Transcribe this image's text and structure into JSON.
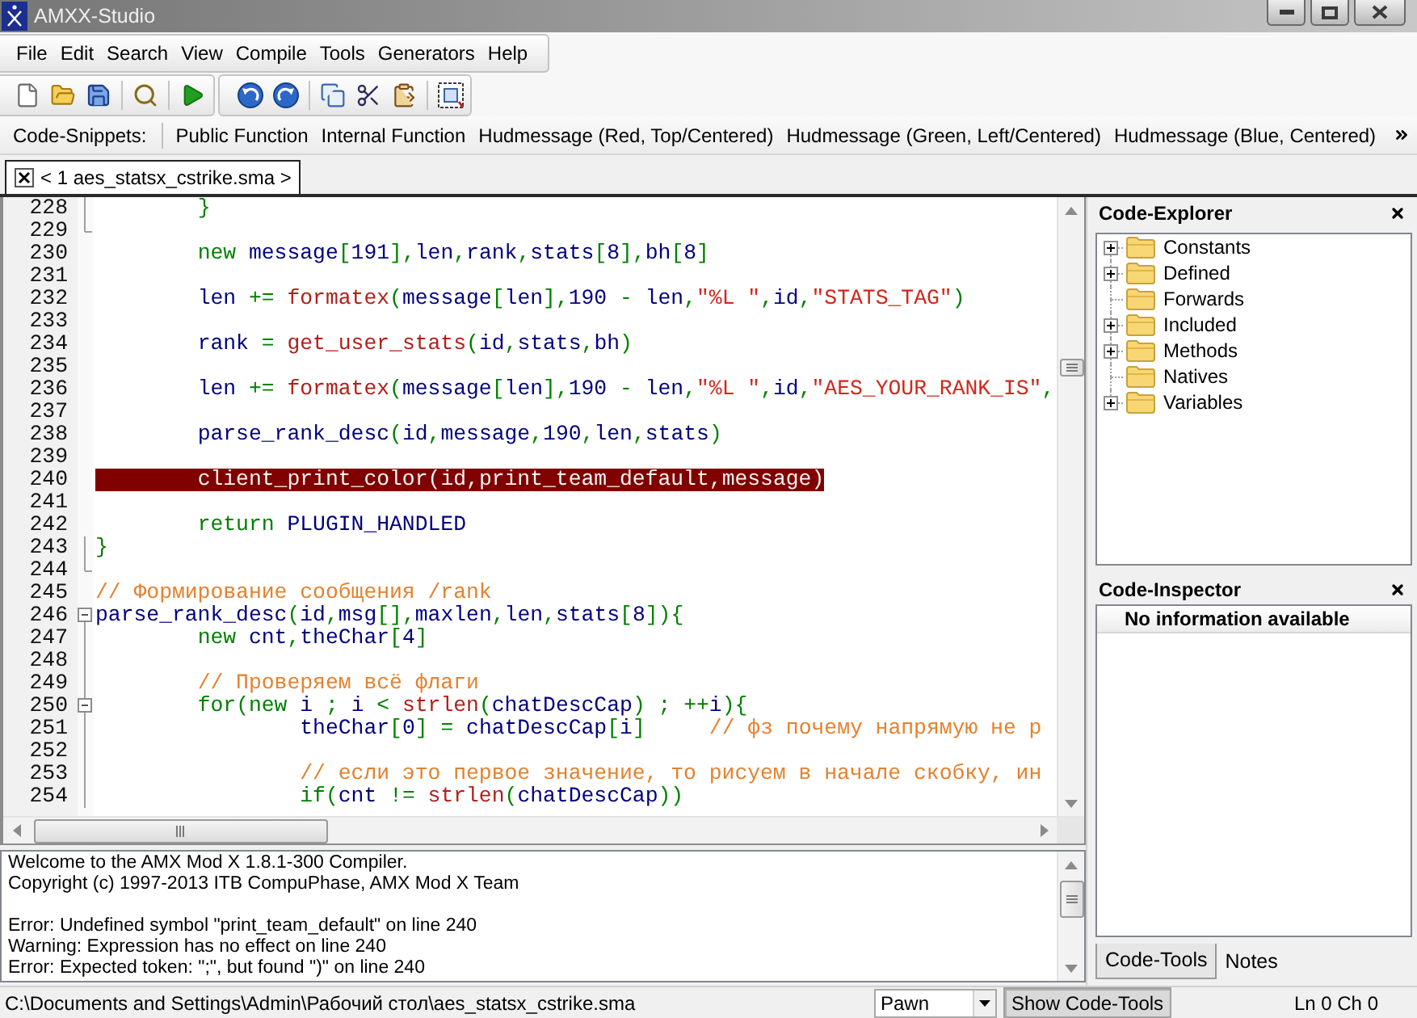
{
  "window": {
    "title": "AMXX-Studio"
  },
  "menu": [
    "File",
    "Edit",
    "Search",
    "View",
    "Compile",
    "Tools",
    "Generators",
    "Help"
  ],
  "snippets": {
    "label": "Code-Snippets:",
    "items": [
      "Public Function",
      "Internal Function",
      "Hudmessage (Red, Top/Centered)",
      "Hudmessage (Green, Left/Centered)",
      "Hudmessage (Blue, Centered)"
    ]
  },
  "tabs": [
    {
      "label": "< 1 aes_statsx_cstrike.sma >",
      "selected": true
    }
  ],
  "editor": {
    "lines": [
      {
        "number": "228",
        "kind": "fold_line",
        "highlighted": false,
        "tokens": [
          {
            "kind": "op",
            "text": "        }"
          }
        ]
      },
      {
        "number": "229",
        "kind": "fold_end",
        "highlighted": false
      },
      {
        "number": "230",
        "kind": "plain",
        "highlighted": false,
        "tokens": [
          {
            "kind": "kw",
            "text": "        new"
          },
          {
            "kind": "id",
            "text": " message"
          },
          {
            "kind": "op",
            "text": "["
          },
          {
            "kind": "id",
            "text": "191"
          },
          {
            "kind": "op",
            "text": "],"
          },
          {
            "kind": "id",
            "text": "len"
          },
          {
            "kind": "op",
            "text": ","
          },
          {
            "kind": "id",
            "text": "rank"
          },
          {
            "kind": "op",
            "text": ","
          },
          {
            "kind": "id",
            "text": "stats"
          },
          {
            "kind": "op",
            "text": "["
          },
          {
            "kind": "id",
            "text": "8"
          },
          {
            "kind": "op",
            "text": "],"
          },
          {
            "kind": "id",
            "text": "bh"
          },
          {
            "kind": "op",
            "text": "["
          },
          {
            "kind": "id",
            "text": "8"
          },
          {
            "kind": "op",
            "text": "]"
          }
        ]
      },
      {
        "number": "231",
        "kind": "plain",
        "highlighted": false
      },
      {
        "number": "232",
        "kind": "plain",
        "highlighted": false,
        "tokens": [
          {
            "kind": "id",
            "text": "        len "
          },
          {
            "kind": "op",
            "text": "+= "
          },
          {
            "kind": "fn",
            "text": "formatex"
          },
          {
            "kind": "op",
            "text": "("
          },
          {
            "kind": "id",
            "text": "message"
          },
          {
            "kind": "op",
            "text": "["
          },
          {
            "kind": "id",
            "text": "len"
          },
          {
            "kind": "op",
            "text": "],"
          },
          {
            "kind": "id",
            "text": "190 "
          },
          {
            "kind": "op",
            "text": "- "
          },
          {
            "kind": "id",
            "text": "len"
          },
          {
            "kind": "op",
            "text": ","
          },
          {
            "kind": "str",
            "text": "\"%L \""
          },
          {
            "kind": "op",
            "text": ","
          },
          {
            "kind": "id",
            "text": "id"
          },
          {
            "kind": "op",
            "text": ","
          },
          {
            "kind": "str",
            "text": "\"STATS_TAG\""
          },
          {
            "kind": "op",
            "text": ")"
          }
        ]
      },
      {
        "number": "233",
        "kind": "plain",
        "highlighted": false
      },
      {
        "number": "234",
        "kind": "plain",
        "highlighted": false,
        "tokens": [
          {
            "kind": "id",
            "text": "        rank "
          },
          {
            "kind": "op",
            "text": "= "
          },
          {
            "kind": "fn",
            "text": "get_user_stats"
          },
          {
            "kind": "op",
            "text": "("
          },
          {
            "kind": "id",
            "text": "id"
          },
          {
            "kind": "op",
            "text": ","
          },
          {
            "kind": "id",
            "text": "stats"
          },
          {
            "kind": "op",
            "text": ","
          },
          {
            "kind": "id",
            "text": "bh"
          },
          {
            "kind": "op",
            "text": ")"
          }
        ]
      },
      {
        "number": "235",
        "kind": "plain",
        "highlighted": false
      },
      {
        "number": "236",
        "kind": "plain",
        "highlighted": false,
        "tokens": [
          {
            "kind": "id",
            "text": "        len "
          },
          {
            "kind": "op",
            "text": "+= "
          },
          {
            "kind": "fn",
            "text": "formatex"
          },
          {
            "kind": "op",
            "text": "("
          },
          {
            "kind": "id",
            "text": "message"
          },
          {
            "kind": "op",
            "text": "["
          },
          {
            "kind": "id",
            "text": "len"
          },
          {
            "kind": "op",
            "text": "],"
          },
          {
            "kind": "id",
            "text": "190 "
          },
          {
            "kind": "op",
            "text": "- "
          },
          {
            "kind": "id",
            "text": "len"
          },
          {
            "kind": "op",
            "text": ","
          },
          {
            "kind": "str",
            "text": "\"%L \""
          },
          {
            "kind": "op",
            "text": ","
          },
          {
            "kind": "id",
            "text": "id"
          },
          {
            "kind": "op",
            "text": ","
          },
          {
            "kind": "str",
            "text": "\"AES_YOUR_RANK_IS\""
          },
          {
            "kind": "op",
            "text": ","
          }
        ]
      },
      {
        "number": "237",
        "kind": "plain",
        "highlighted": false
      },
      {
        "number": "238",
        "kind": "plain",
        "highlighted": false,
        "tokens": [
          {
            "kind": "id",
            "text": "        parse_rank_desc"
          },
          {
            "kind": "op",
            "text": "("
          },
          {
            "kind": "id",
            "text": "id"
          },
          {
            "kind": "op",
            "text": ","
          },
          {
            "kind": "id",
            "text": "message"
          },
          {
            "kind": "op",
            "text": ","
          },
          {
            "kind": "id",
            "text": "190"
          },
          {
            "kind": "op",
            "text": ","
          },
          {
            "kind": "id",
            "text": "len"
          },
          {
            "kind": "op",
            "text": ","
          },
          {
            "kind": "id",
            "text": "stats"
          },
          {
            "kind": "op",
            "text": ")"
          }
        ]
      },
      {
        "number": "239",
        "kind": "plain",
        "highlighted": false
      },
      {
        "number": "240",
        "kind": "plain",
        "highlighted": true,
        "tokens": [
          {
            "kind": "id",
            "text": "        client_print_color"
          },
          {
            "kind": "op",
            "text": "("
          },
          {
            "kind": "id",
            "text": "id"
          },
          {
            "kind": "op",
            "text": ","
          },
          {
            "kind": "id",
            "text": "print_team_default"
          },
          {
            "kind": "op",
            "text": ","
          },
          {
            "kind": "id",
            "text": "message"
          },
          {
            "kind": "op",
            "text": ")"
          }
        ]
      },
      {
        "number": "241",
        "kind": "plain",
        "highlighted": false
      },
      {
        "number": "242",
        "kind": "plain",
        "highlighted": false,
        "tokens": [
          {
            "kind": "kw",
            "text": "        return"
          },
          {
            "kind": "id",
            "text": " PLUGIN_HANDLED"
          }
        ]
      },
      {
        "number": "243",
        "kind": "fold_line",
        "highlighted": false,
        "tokens": [
          {
            "kind": "op",
            "text": "}"
          }
        ]
      },
      {
        "number": "244",
        "kind": "fold_end",
        "highlighted": false
      },
      {
        "number": "245",
        "kind": "plain",
        "highlighted": false,
        "tokens": [
          {
            "kind": "comment",
            "text": "// Формирование сообщения /rank"
          }
        ]
      },
      {
        "number": "246",
        "kind": "fold_start",
        "highlighted": false,
        "tokens": [
          {
            "kind": "id",
            "text": "parse_rank_desc"
          },
          {
            "kind": "op",
            "text": "("
          },
          {
            "kind": "id",
            "text": "id"
          },
          {
            "kind": "op",
            "text": ","
          },
          {
            "kind": "id",
            "text": "msg"
          },
          {
            "kind": "op",
            "text": "[],"
          },
          {
            "kind": "id",
            "text": "maxlen"
          },
          {
            "kind": "op",
            "text": ","
          },
          {
            "kind": "id",
            "text": "len"
          },
          {
            "kind": "op",
            "text": ","
          },
          {
            "kind": "id",
            "text": "stats"
          },
          {
            "kind": "op",
            "text": "["
          },
          {
            "kind": "id",
            "text": "8"
          },
          {
            "kind": "op",
            "text": "]){"
          }
        ]
      },
      {
        "number": "247",
        "kind": "fold_line",
        "highlighted": false,
        "tokens": [
          {
            "kind": "kw",
            "text": "        new"
          },
          {
            "kind": "id",
            "text": " cnt"
          },
          {
            "kind": "op",
            "text": ","
          },
          {
            "kind": "id",
            "text": "theChar"
          },
          {
            "kind": "op",
            "text": "["
          },
          {
            "kind": "id",
            "text": "4"
          },
          {
            "kind": "op",
            "text": "]"
          }
        ]
      },
      {
        "number": "248",
        "kind": "fold_line",
        "highlighted": false
      },
      {
        "number": "249",
        "kind": "fold_line",
        "highlighted": false,
        "tokens": [
          {
            "kind": "comment",
            "text": "        // Проверяем всё флаги"
          }
        ]
      },
      {
        "number": "250",
        "kind": "fold_inner_start",
        "highlighted": false,
        "tokens": [
          {
            "kind": "kw",
            "text": "        for"
          },
          {
            "kind": "op",
            "text": "("
          },
          {
            "kind": "kw",
            "text": "new"
          },
          {
            "kind": "id",
            "text": " i "
          },
          {
            "kind": "op",
            "text": "; "
          },
          {
            "kind": "id",
            "text": "i "
          },
          {
            "kind": "op",
            "text": "< "
          },
          {
            "kind": "fn",
            "text": "strlen"
          },
          {
            "kind": "op",
            "text": "("
          },
          {
            "kind": "id",
            "text": "chatDescCap"
          },
          {
            "kind": "op",
            "text": ") ; ++"
          },
          {
            "kind": "id",
            "text": "i"
          },
          {
            "kind": "op",
            "text": "){"
          }
        ]
      },
      {
        "number": "251",
        "kind": "fold_line",
        "highlighted": false,
        "tokens": [
          {
            "kind": "id",
            "text": "                theChar"
          },
          {
            "kind": "op",
            "text": "["
          },
          {
            "kind": "id",
            "text": "0"
          },
          {
            "kind": "op",
            "text": "] = "
          },
          {
            "kind": "id",
            "text": "chatDescCap"
          },
          {
            "kind": "op",
            "text": "["
          },
          {
            "kind": "id",
            "text": "i"
          },
          {
            "kind": "op",
            "text": "]"
          },
          {
            "kind": "comment",
            "text": "     // фз почему напрямую не р"
          }
        ]
      },
      {
        "number": "252",
        "kind": "fold_line",
        "highlighted": false
      },
      {
        "number": "253",
        "kind": "fold_line",
        "highlighted": false,
        "tokens": [
          {
            "kind": "comment",
            "text": "                // если это первое значение, то рисуем в начале скобку, ин"
          }
        ]
      },
      {
        "number": "254",
        "kind": "fold_line",
        "highlighted": false,
        "tokens": [
          {
            "kind": "kw",
            "text": "                if"
          },
          {
            "kind": "op",
            "text": "("
          },
          {
            "kind": "id",
            "text": "cnt "
          },
          {
            "kind": "op",
            "text": "!= "
          },
          {
            "kind": "fn",
            "text": "strlen"
          },
          {
            "kind": "op",
            "text": "("
          },
          {
            "kind": "id",
            "text": "chatDescCap"
          },
          {
            "kind": "op",
            "text": "))"
          }
        ]
      }
    ]
  },
  "output": {
    "blocks": [
      [
        "Welcome to the AMX Mod X 1.8.1-300 Compiler.",
        "Copyright (c) 1997-2013 ITB CompuPhase, AMX Mod X Team"
      ],
      [
        "Error: Undefined symbol \"print_team_default\" on line 240",
        "Warning: Expression has no effect on line 240",
        "Error: Expected token: \";\", but found \")\" on line 240"
      ]
    ]
  },
  "code_explorer": {
    "title": "Code-Explorer",
    "items": [
      {
        "label": "Constants",
        "expandable": true
      },
      {
        "label": "Defined",
        "expandable": true
      },
      {
        "label": "Forwards",
        "expandable": false
      },
      {
        "label": "Included",
        "expandable": true
      },
      {
        "label": "Methods",
        "expandable": true
      },
      {
        "label": "Natives",
        "expandable": false
      },
      {
        "label": "Variables",
        "expandable": true
      }
    ]
  },
  "code_inspector": {
    "title": "Code-Inspector",
    "message": "No information available"
  },
  "panel_tabs": [
    {
      "label": "Code-Tools",
      "selected": true
    },
    {
      "label": "Notes",
      "selected": false
    }
  ],
  "status_bar": {
    "path": "C:\\Documents and Settings\\Admin\\Рабочий стол\\aes_statsx_cstrike.sma",
    "language": "Pawn",
    "toggle": {
      "label": "Show Code-Tools",
      "on": true
    },
    "position": "Ln 0 Ch 0"
  }
}
